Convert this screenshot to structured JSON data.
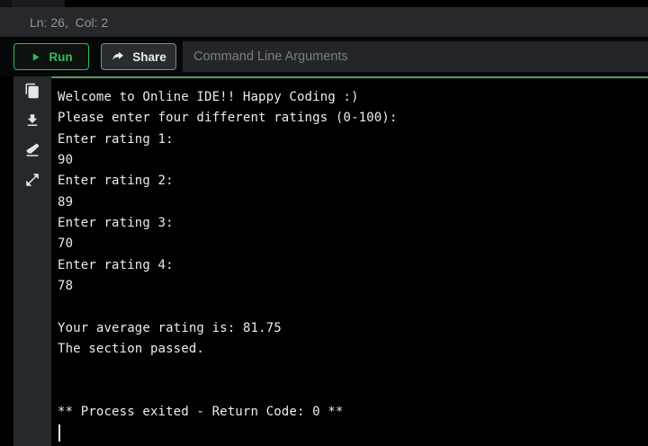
{
  "status_bar": {
    "cursor_position": "Ln: 26,  Col: 2"
  },
  "toolbar": {
    "run_label": "Run",
    "share_label": "Share",
    "cli_placeholder": "Command Line Arguments"
  },
  "sidebar": {
    "icons": [
      "copy-icon",
      "download-icon",
      "erase-console-icon",
      "expand-icon"
    ]
  },
  "console": {
    "text": "Welcome to Online IDE!! Happy Coding :)\nPlease enter four different ratings (0-100):\nEnter rating 1:\n90\nEnter rating 2:\n89\nEnter rating 3:\n70\nEnter rating 4:\n78\n\nYour average rating is: 81.75\nThe section passed.\n\n\n** Process exited - Return Code: 0 **",
    "exit_code": "0",
    "average_rating": "81.75",
    "ratings_entered": [
      "90",
      "89",
      "70",
      "78"
    ]
  },
  "colors": {
    "accent_green": "#2ebd5e",
    "console_divider_green": "#53a05e",
    "statusbar_bg": "#26282b",
    "sidebar_bg": "#26292c",
    "console_bg": "#010101",
    "console_text": "#ebecec"
  }
}
